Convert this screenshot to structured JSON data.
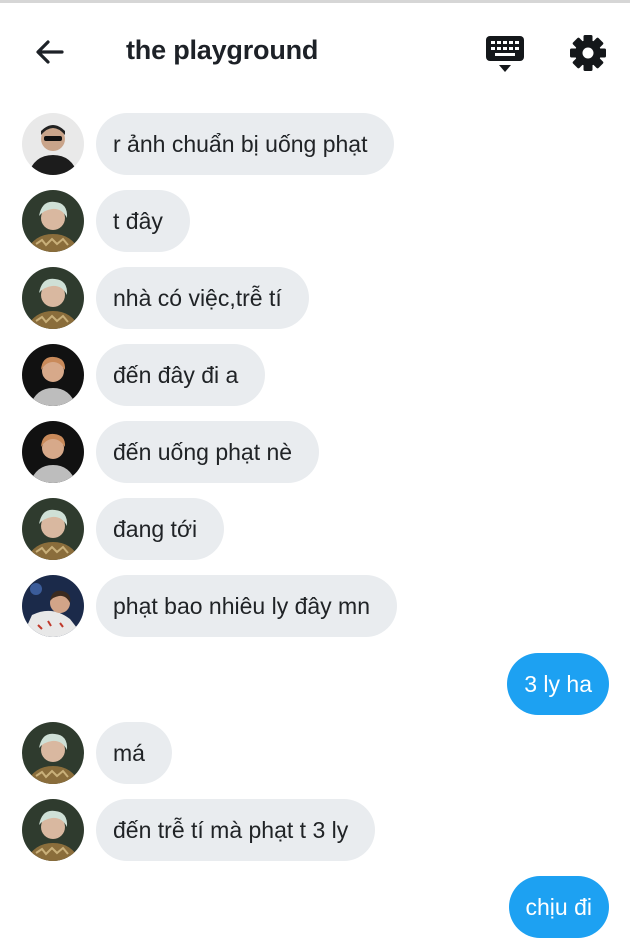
{
  "header": {
    "title": "the playground",
    "back_icon": "arrow-left-icon",
    "keyboard_icon": "keyboard-icon",
    "settings_icon": "gear-icon"
  },
  "colors": {
    "incoming_bubble": "#e9ecef",
    "outgoing_bubble": "#1da1f2",
    "text": "#202326"
  },
  "messages": [
    {
      "direction": "in",
      "avatar": "avatar-user-a",
      "text": "r ảnh chuẩn bị uống phạt"
    },
    {
      "direction": "in",
      "avatar": "avatar-user-b",
      "text": "t đây"
    },
    {
      "direction": "in",
      "avatar": "avatar-user-b",
      "text": "nhà có việc,trễ tí"
    },
    {
      "direction": "in",
      "avatar": "avatar-user-c",
      "text": "đến đây đi a"
    },
    {
      "direction": "in",
      "avatar": "avatar-user-c",
      "text": "đến uống phạt nè"
    },
    {
      "direction": "in",
      "avatar": "avatar-user-b",
      "text": "đang tới"
    },
    {
      "direction": "in",
      "avatar": "avatar-user-d",
      "text": "phạt bao nhiêu ly đây mn"
    },
    {
      "direction": "out",
      "text": "3 ly ha"
    },
    {
      "direction": "in",
      "avatar": "avatar-user-b",
      "text": "má"
    },
    {
      "direction": "in",
      "avatar": "avatar-user-b",
      "text": "đến trễ tí mà phạt t 3 ly"
    },
    {
      "direction": "out",
      "text": "chịu đi"
    }
  ]
}
